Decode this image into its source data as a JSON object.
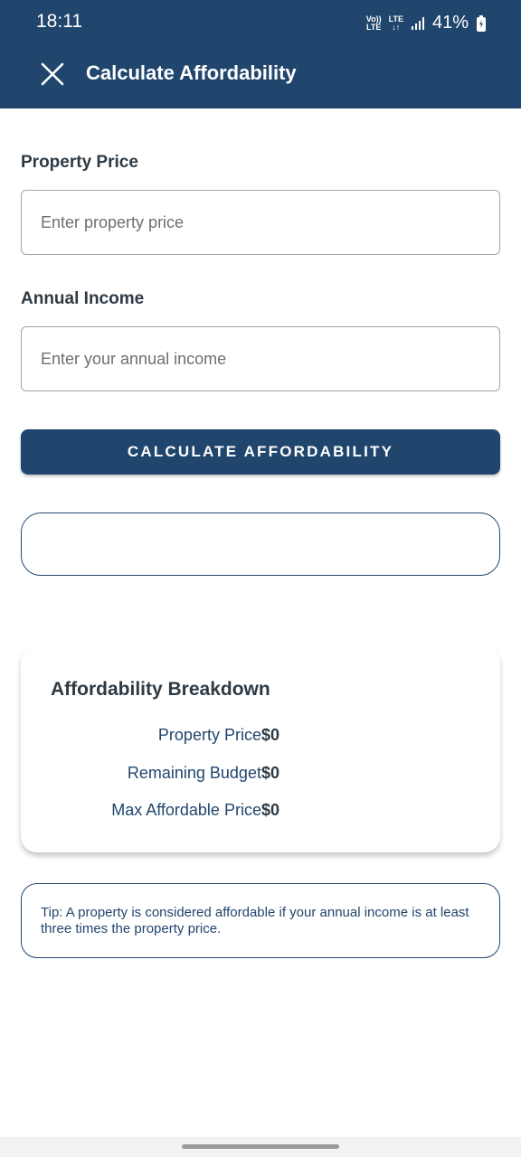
{
  "status_bar": {
    "time": "18:11",
    "volte": "Vo)) LTE",
    "lte": "LTE",
    "battery": "41%"
  },
  "app_bar": {
    "title": "Calculate Affordability",
    "close_icon": "close-icon"
  },
  "form": {
    "property_price": {
      "label": "Property Price",
      "value": "",
      "placeholder": "Enter property price"
    },
    "annual_income": {
      "label": "Annual Income",
      "value": "",
      "placeholder": "Enter your annual income"
    },
    "calculate_button": "CALCULATE AFFORDABILITY"
  },
  "result": {
    "text": ""
  },
  "breakdown": {
    "title": "Affordability Breakdown",
    "rows": [
      {
        "label": "Property Price",
        "value": "$0"
      },
      {
        "label": "Remaining Budget",
        "value": "$0"
      },
      {
        "label": "Max Affordable Price",
        "value": "$0"
      }
    ]
  },
  "tip": {
    "text": "Tip: A property is considered affordable if your annual income is at least three times the property price."
  },
  "colors": {
    "primary": "#21466d",
    "text_dark": "#2e3a44",
    "background": "#ffffff"
  }
}
